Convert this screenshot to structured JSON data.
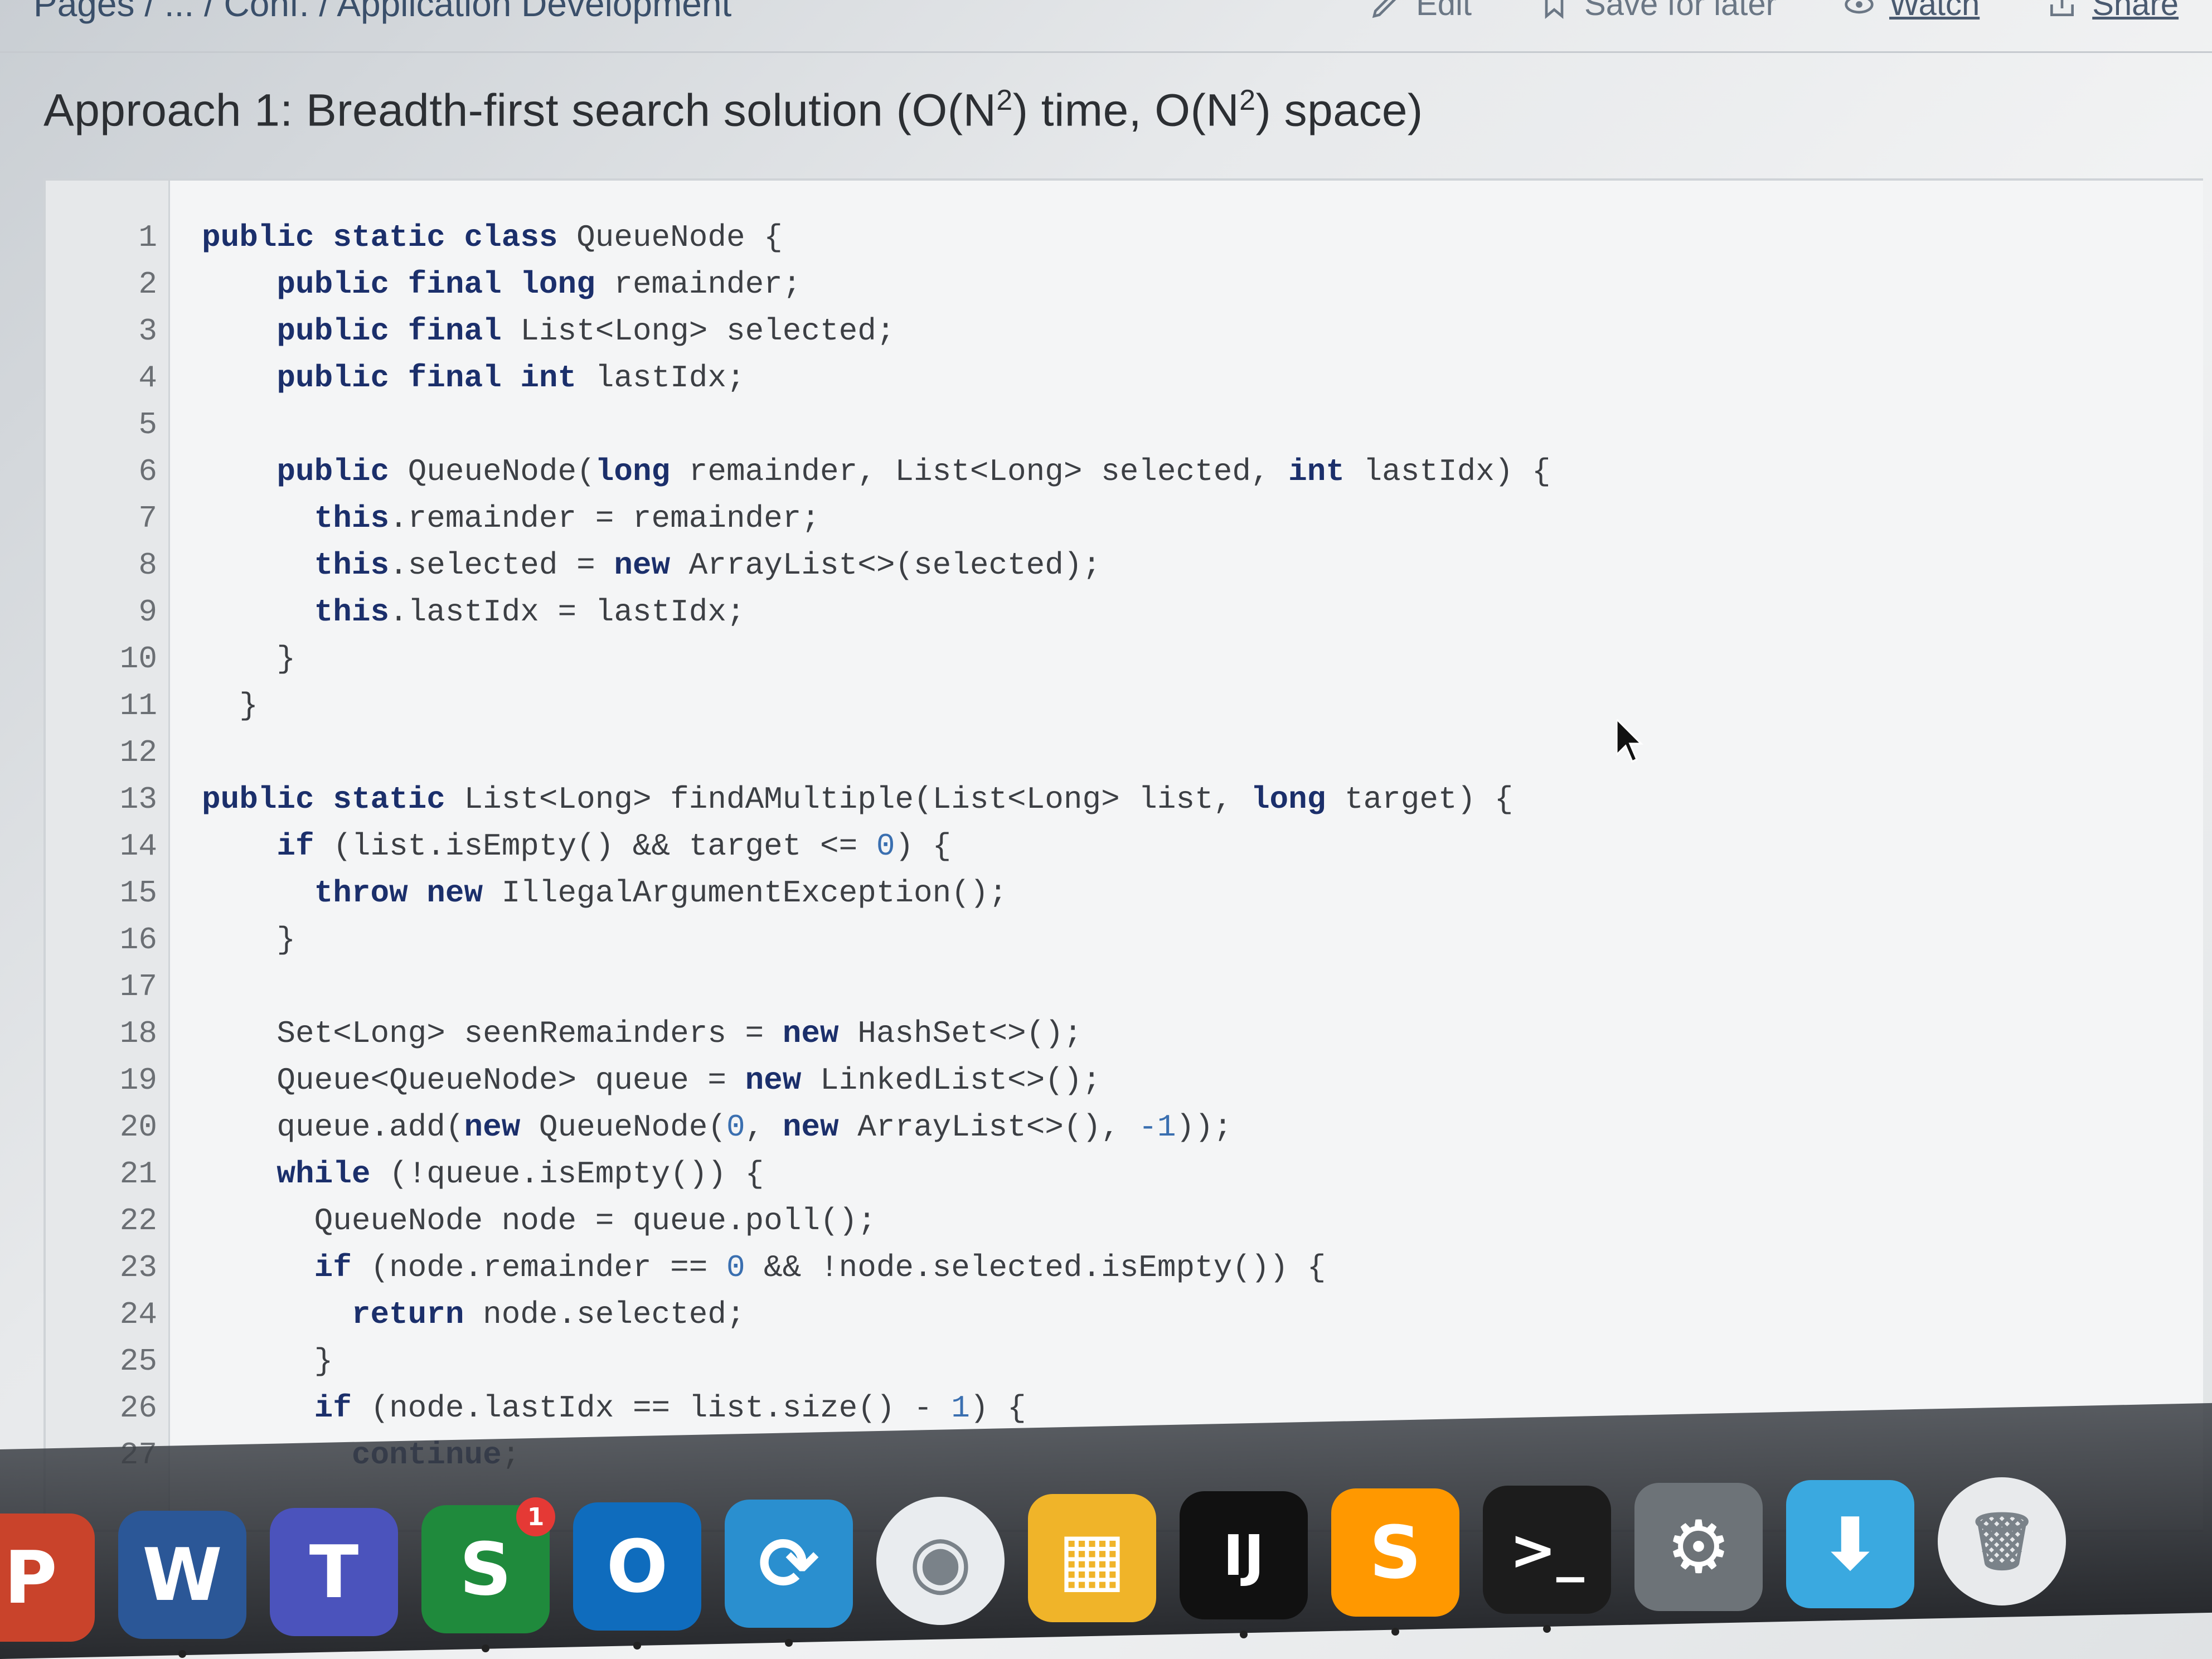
{
  "topbar": {
    "breadcrumb": "Pages / ... / Conf. / Application Development",
    "actions": {
      "edit": "Edit",
      "save_for_later": "Save for later",
      "watch": "Watch",
      "share": "Share"
    }
  },
  "heading": {
    "prefix": "Approach 1: Breadth-first search solution (O(N",
    "exp1": "2",
    "middle": ") time, O(N",
    "exp2": "2",
    "suffix": ") space)"
  },
  "code": {
    "language": "java",
    "lines": [
      {
        "n": "1",
        "text": "public static class QueueNode {"
      },
      {
        "n": "2",
        "text": "    public final long remainder;"
      },
      {
        "n": "3",
        "text": "    public final List<Long> selected;"
      },
      {
        "n": "4",
        "text": "    public final int lastIdx;"
      },
      {
        "n": "5",
        "text": ""
      },
      {
        "n": "6",
        "text": "    public QueueNode(long remainder, List<Long> selected, int lastIdx) {"
      },
      {
        "n": "7",
        "text": "      this.remainder = remainder;"
      },
      {
        "n": "8",
        "text": "      this.selected = new ArrayList<>(selected);"
      },
      {
        "n": "9",
        "text": "      this.lastIdx = lastIdx;"
      },
      {
        "n": "10",
        "text": "    }"
      },
      {
        "n": "11",
        "text": "  }"
      },
      {
        "n": "12",
        "text": ""
      },
      {
        "n": "13",
        "text": "public static List<Long> findAMultiple(List<Long> list, long target) {"
      },
      {
        "n": "14",
        "text": "    if (list.isEmpty() && target <= 0) {"
      },
      {
        "n": "15",
        "text": "      throw new IllegalArgumentException();"
      },
      {
        "n": "16",
        "text": "    }"
      },
      {
        "n": "17",
        "text": ""
      },
      {
        "n": "18",
        "text": "    Set<Long> seenRemainders = new HashSet<>();"
      },
      {
        "n": "19",
        "text": "    Queue<QueueNode> queue = new LinkedList<>();"
      },
      {
        "n": "20",
        "text": "    queue.add(new QueueNode(0, new ArrayList<>(), -1));"
      },
      {
        "n": "21",
        "text": "    while (!queue.isEmpty()) {"
      },
      {
        "n": "22",
        "text": "      QueueNode node = queue.poll();"
      },
      {
        "n": "23",
        "text": "      if (node.remainder == 0 && !node.selected.isEmpty()) {"
      },
      {
        "n": "24",
        "text": "        return node.selected;"
      },
      {
        "n": "25",
        "text": "      }"
      },
      {
        "n": "26",
        "text": "      if (node.lastIdx == list.size() - 1) {"
      },
      {
        "n": "27",
        "text": "        continue;"
      }
    ]
  },
  "dock": {
    "items": [
      {
        "name": "powerpoint-icon",
        "glyph": "P",
        "color": "#c9432b"
      },
      {
        "name": "word-icon",
        "glyph": "W",
        "color": "#2b5797"
      },
      {
        "name": "teams-icon",
        "glyph": "T",
        "color": "#4b53bc"
      },
      {
        "name": "skype-for-business-icon",
        "glyph": "S",
        "color": "#1f8a3c",
        "badge": "1"
      },
      {
        "name": "outlook-icon",
        "glyph": "O",
        "color": "#0f6cbd"
      },
      {
        "name": "vpn-client-icon",
        "glyph": "⟳",
        "color": "#2a8fcf"
      },
      {
        "name": "wifi-utility-icon",
        "glyph": "◉",
        "color": "#e9ecef"
      },
      {
        "name": "self-service-icon",
        "glyph": "▦",
        "color": "#f0b429"
      },
      {
        "name": "intellij-idea-icon",
        "glyph": "IJ",
        "color": "#111111"
      },
      {
        "name": "sublime-text-icon",
        "glyph": "S",
        "color": "#ff9800"
      },
      {
        "name": "terminal-icon",
        "glyph": ">_",
        "color": "#1c1c1c"
      },
      {
        "name": "system-preferences-icon",
        "glyph": "⚙",
        "color": "#6d7378"
      },
      {
        "name": "downloads-folder-icon",
        "glyph": "⬇",
        "color": "#3aa9e0"
      },
      {
        "name": "trash-icon",
        "glyph": "🗑",
        "color": "#e8eaec"
      }
    ]
  }
}
